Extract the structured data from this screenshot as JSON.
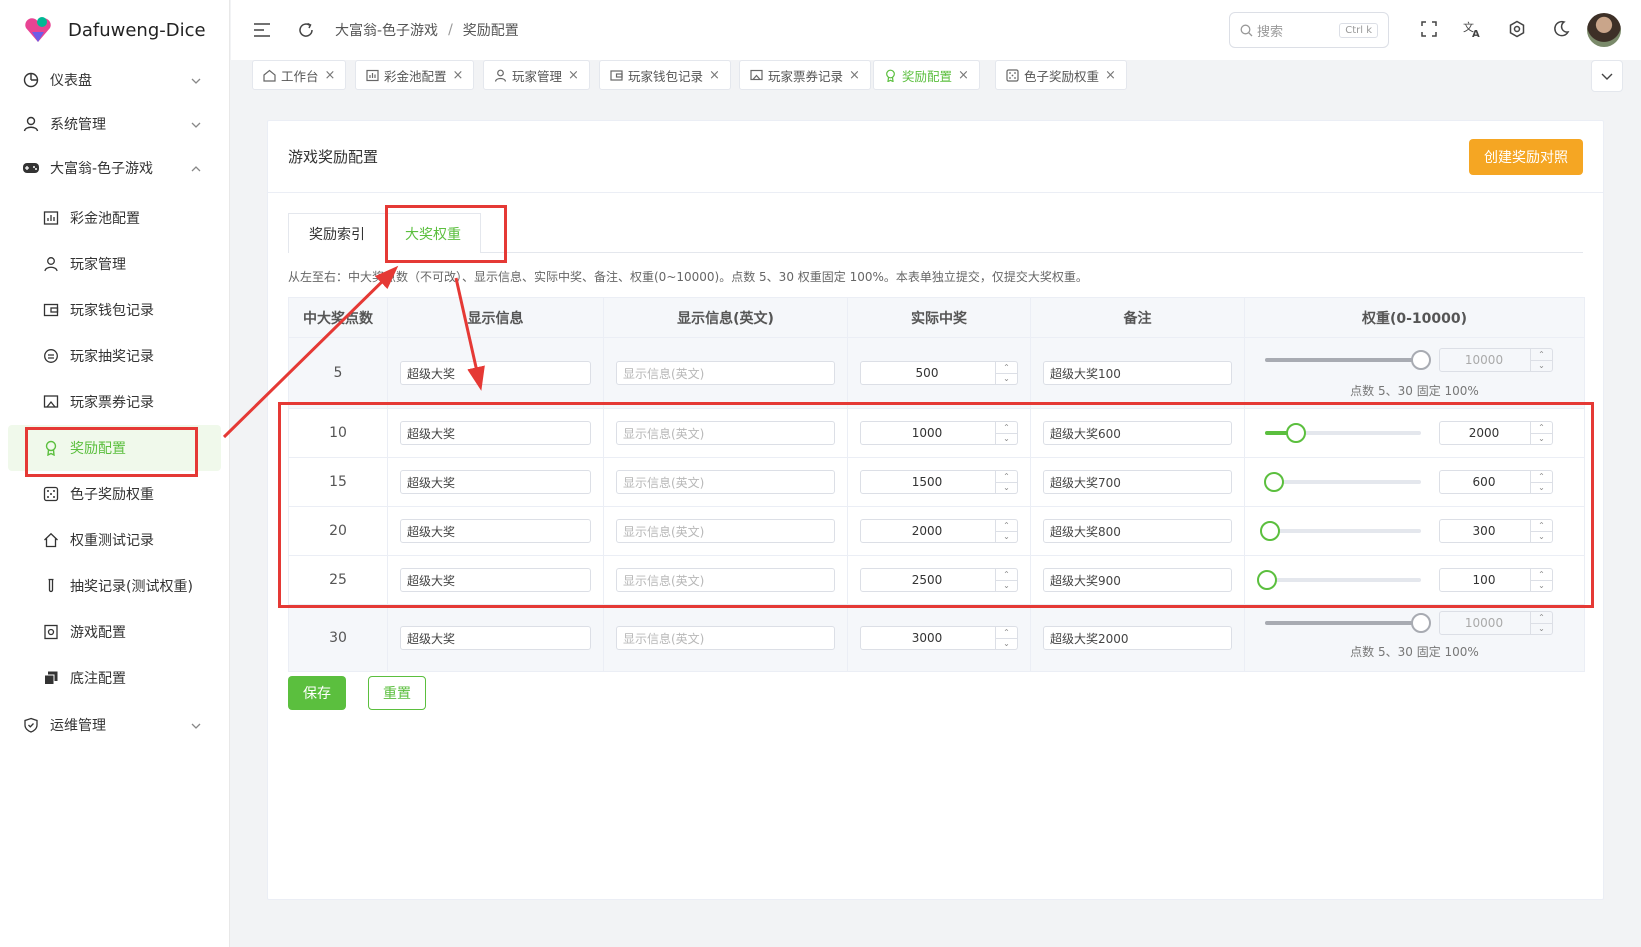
{
  "app": {
    "title": "Dafuweng-Dice"
  },
  "sidebar": {
    "groups": [
      {
        "label": "仪表盘",
        "icon": "dashboard-icon"
      },
      {
        "label": "系统管理",
        "icon": "user-icon"
      },
      {
        "label": "大富翁-色子游戏",
        "icon": "gamepad-icon"
      }
    ],
    "sub_items": [
      {
        "label": "彩金池配置",
        "icon": "chart-icon"
      },
      {
        "label": "玩家管理",
        "icon": "user-icon"
      },
      {
        "label": "玩家钱包记录",
        "icon": "wallet-icon"
      },
      {
        "label": "玩家抽奖记录",
        "icon": "record-icon"
      },
      {
        "label": "玩家票券记录",
        "icon": "ticket-icon"
      },
      {
        "label": "奖励配置",
        "icon": "award-icon"
      },
      {
        "label": "色子奖励权重",
        "icon": "dice-icon"
      },
      {
        "label": "权重测试记录",
        "icon": "home-icon"
      },
      {
        "label": "抽奖记录(测试权重)",
        "icon": "test-tube-icon"
      },
      {
        "label": "游戏配置",
        "icon": "settings-icon"
      },
      {
        "label": "底注配置",
        "icon": "stack-icon"
      }
    ],
    "ops": {
      "label": "运维管理",
      "icon": "shield-icon"
    }
  },
  "header": {
    "breadcrumb": [
      "大富翁-色子游戏",
      "奖励配置"
    ],
    "search_placeholder": "搜索",
    "search_kbd": "Ctrl k"
  },
  "tabs": [
    {
      "label": "工作台"
    },
    {
      "label": "彩金池配置"
    },
    {
      "label": "玩家管理"
    },
    {
      "label": "玩家钱包记录"
    },
    {
      "label": "玩家票券记录"
    },
    {
      "label": "奖励配置"
    },
    {
      "label": "色子奖励权重"
    }
  ],
  "card": {
    "title": "游戏奖励配置",
    "create_button": "创建奖励对照",
    "inner_tabs": [
      "奖励索引",
      "大奖权重"
    ],
    "hint": "从左至右：中大奖点数（不可改）、显示信息、实际中奖、备注、权重(0~10000)。点数 5、30 权重固定 100%。本表单独立提交，仅提交大奖权重。",
    "columns": [
      "中大奖点数",
      "显示信息",
      "显示信息(英文)",
      "实际中奖",
      "备注",
      "权重(0-10000)"
    ],
    "rows": [
      {
        "points": "5",
        "display": "超级大奖",
        "display_en": "显示信息(英文)",
        "actual": "500",
        "note": "超级大奖100",
        "weight": "10000",
        "weight_fraction": 1.0,
        "fixed": true,
        "fixed_note": "点数 5、30 固定 100%"
      },
      {
        "points": "10",
        "display": "超级大奖",
        "display_en": "显示信息(英文)",
        "actual": "1000",
        "note": "超级大奖600",
        "weight": "2000",
        "weight_fraction": 0.2,
        "fixed": false
      },
      {
        "points": "15",
        "display": "超级大奖",
        "display_en": "显示信息(英文)",
        "actual": "1500",
        "note": "超级大奖700",
        "weight": "600",
        "weight_fraction": 0.06,
        "fixed": false
      },
      {
        "points": "20",
        "display": "超级大奖",
        "display_en": "显示信息(英文)",
        "actual": "2000",
        "note": "超级大奖800",
        "weight": "300",
        "weight_fraction": 0.03,
        "fixed": false
      },
      {
        "points": "25",
        "display": "超级大奖",
        "display_en": "显示信息(英文)",
        "actual": "2500",
        "note": "超级大奖900",
        "weight": "100",
        "weight_fraction": 0.01,
        "fixed": false
      },
      {
        "points": "30",
        "display": "超级大奖",
        "display_en": "显示信息(英文)",
        "actual": "3000",
        "note": "超级大奖2000",
        "weight": "10000",
        "weight_fraction": 1.0,
        "fixed": true,
        "fixed_note": "点数 5、30 固定 100%"
      }
    ],
    "save_button": "保存",
    "reset_button": "重置"
  },
  "colors": {
    "accent": "#5bbf3e",
    "orange": "#f5a623",
    "annotation": "#e53935"
  }
}
